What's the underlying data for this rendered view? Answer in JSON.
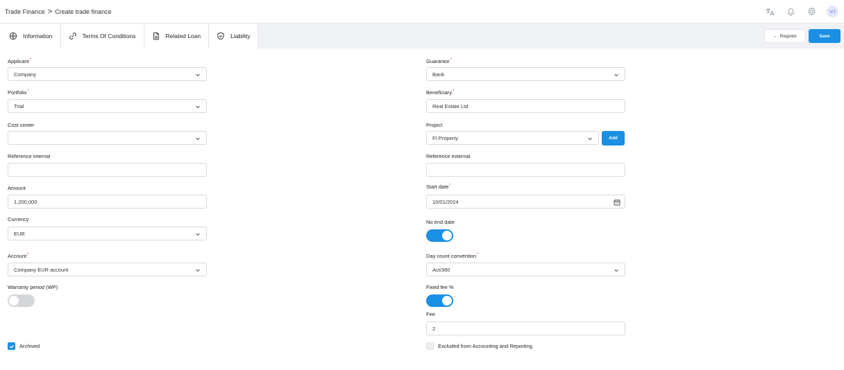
{
  "breadcrumb": {
    "root": "Trade Finance",
    "separator": ">",
    "current": "Create trade finance"
  },
  "user": {
    "initials": "VJ"
  },
  "tabs": [
    {
      "label": "Information",
      "icon": "info-gear-icon"
    },
    {
      "label": "Terms Of Conditions",
      "icon": "link-icon"
    },
    {
      "label": "Related Loan",
      "icon": "document-icon"
    },
    {
      "label": "Liability",
      "icon": "shield-check-icon"
    }
  ],
  "actions": {
    "register": "Register",
    "save": "Save",
    "add": "Add"
  },
  "left": {
    "applicant": {
      "label": "Applicant",
      "value": "Company"
    },
    "portfolio": {
      "label": "Portfolio",
      "value": "Trial"
    },
    "cost_center": {
      "label": "Cost center",
      "value": ""
    },
    "reference_internal": {
      "label": "Reference internal",
      "value": ""
    },
    "amount": {
      "label": "Amount",
      "value": "1,200,000"
    },
    "currency": {
      "label": "Currency",
      "value": "EUR"
    },
    "account": {
      "label": "Account",
      "value": "Company EUR account"
    },
    "warranty_period": {
      "label": "Warranty period (WP)",
      "on": false
    },
    "archived": {
      "label": "Archived",
      "checked": true
    }
  },
  "right": {
    "guarantor": {
      "label": "Guarantor",
      "value": "Bank"
    },
    "beneficiary": {
      "label": "Beneficiary",
      "value": "Real Estate Ltd"
    },
    "project": {
      "label": "Project",
      "value": "FI Property"
    },
    "reference_external": {
      "label": "Reference external",
      "value": ""
    },
    "start_date": {
      "label": "Start date",
      "value": "10/01/2024"
    },
    "no_end_date": {
      "label": "No end date",
      "on": true
    },
    "day_count": {
      "label": "Day count convention",
      "value": "Act/360"
    },
    "fixed_fee": {
      "label": "Fixed fee %",
      "on": true
    },
    "fee": {
      "label": "Fee",
      "value": "2"
    },
    "excluded": {
      "label": "Excluded from Accounting and Reporting",
      "checked": false
    }
  },
  "colors": {
    "accent": "#1a8fe3",
    "required": "#e24b4b",
    "tabbar_bg": "#f1f2f5"
  }
}
